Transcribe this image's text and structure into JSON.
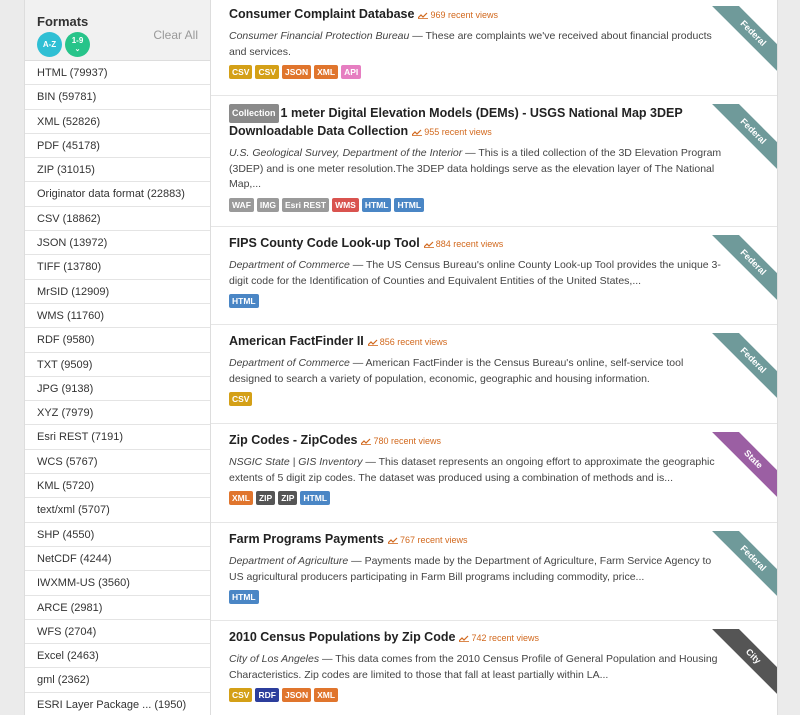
{
  "sidebar": {
    "facet_title": "Formats",
    "sort_az": "A-Z",
    "sort_19": "1-9",
    "clear_all": "Clear All",
    "items": [
      "HTML (79937)",
      "BIN (59781)",
      "XML (52826)",
      "PDF (45178)",
      "ZIP (31015)",
      "Originator data format (22883)",
      "CSV (18862)",
      "JSON (13972)",
      "TIFF (13780)",
      "MrSID (12909)",
      "WMS (11760)",
      "RDF (9580)",
      "TXT (9509)",
      "JPG (9138)",
      "XYZ (7979)",
      "Esri REST (7191)",
      "WCS (5767)",
      "KML (5720)",
      "text/xml (5707)",
      "SHP (4550)",
      "NetCDF (4244)",
      "IWXMM-US (3560)",
      "ARCE (2981)",
      "WFS (2704)",
      "Excel (2463)",
      "gml (2362)",
      "ESRI Layer Package ... (1950)"
    ]
  },
  "colors": {
    "federal": "#6f9a9a",
    "state": "#9b5fa3",
    "city": "#555555",
    "views": "#d2691e"
  },
  "results": [
    {
      "title": "Consumer Complaint Database",
      "collection": "",
      "views": "969 recent views",
      "org": "Consumer Financial Protection Bureau",
      "desc": " — These are complaints we've received about financial products and services.",
      "ribbon": "Federal",
      "badges": [
        {
          "label": "CSV",
          "color": "#d4a017"
        },
        {
          "label": "CSV",
          "color": "#d4a017"
        },
        {
          "label": "JSON",
          "color": "#e0752d"
        },
        {
          "label": "XML",
          "color": "#e0752d"
        },
        {
          "label": "API",
          "color": "#e67ec1"
        }
      ]
    },
    {
      "title": "1 meter Digital Elevation Models (DEMs) - USGS National Map 3DEP Downloadable Data Collection",
      "collection": "Collection",
      "views": "955 recent views",
      "org": "U.S. Geological Survey, Department of the Interior",
      "desc": " — This is a tiled collection of the 3D Elevation Program (3DEP) and is one meter resolution.The 3DEP data holdings serve as the elevation layer of The National Map,...",
      "ribbon": "Federal",
      "badges": [
        {
          "label": "WAF",
          "color": "#9a9a9a"
        },
        {
          "label": "IMG",
          "color": "#9a9a9a"
        },
        {
          "label": "Esri REST",
          "color": "#9a9a9a"
        },
        {
          "label": "WMS",
          "color": "#d9534f"
        },
        {
          "label": "HTML",
          "color": "#4a86c5"
        },
        {
          "label": "HTML",
          "color": "#4a86c5"
        }
      ]
    },
    {
      "title": "FIPS County Code Look-up Tool",
      "collection": "",
      "views": "884 recent views",
      "org": "Department of Commerce",
      "desc": " — The US Census Bureau's online County Look-up Tool provides the unique 3-digit code for the Identification of Counties and Equivalent Entities of the United States,...",
      "ribbon": "Federal",
      "badges": [
        {
          "label": "HTML",
          "color": "#4a86c5"
        }
      ]
    },
    {
      "title": "American FactFinder II",
      "collection": "",
      "views": "856 recent views",
      "org": "Department of Commerce",
      "desc": " — American FactFinder is the Census Bureau's online, self-service tool designed to search a variety of population, economic, geographic and housing information.",
      "ribbon": "Federal",
      "badges": [
        {
          "label": "CSV",
          "color": "#d4a017"
        }
      ]
    },
    {
      "title": "Zip Codes - ZipCodes",
      "collection": "",
      "views": "780 recent views",
      "org": "NSGIC State | GIS Inventory",
      "desc": " — This dataset represents an ongoing effort to approximate the geographic extents of 5 digit zip codes. The dataset was produced using a combination of methods and is...",
      "ribbon": "State",
      "badges": [
        {
          "label": "XML",
          "color": "#e0752d"
        },
        {
          "label": "ZIP",
          "color": "#555555"
        },
        {
          "label": "ZIP",
          "color": "#555555"
        },
        {
          "label": "HTML",
          "color": "#4a86c5"
        }
      ]
    },
    {
      "title": "Farm Programs Payments",
      "collection": "",
      "views": "767 recent views",
      "org": "Department of Agriculture",
      "desc": " — Payments made by the Department of Agriculture, Farm Service Agency to US agricultural producers participating in Farm Bill programs including commodity, price...",
      "ribbon": "Federal",
      "badges": [
        {
          "label": "HTML",
          "color": "#4a86c5"
        }
      ]
    },
    {
      "title": "2010 Census Populations by Zip Code",
      "collection": "",
      "views": "742 recent views",
      "org": "City of Los Angeles",
      "desc": " — This data comes from the 2010 Census Profile of General Population and Housing Characteristics. Zip codes are limited to those that fall at least partially within LA...",
      "ribbon": "City",
      "badges": [
        {
          "label": "CSV",
          "color": "#d4a017"
        },
        {
          "label": "RDF",
          "color": "#2c3e9c"
        },
        {
          "label": "JSON",
          "color": "#e0752d"
        },
        {
          "label": "XML",
          "color": "#e0752d"
        }
      ]
    }
  ]
}
